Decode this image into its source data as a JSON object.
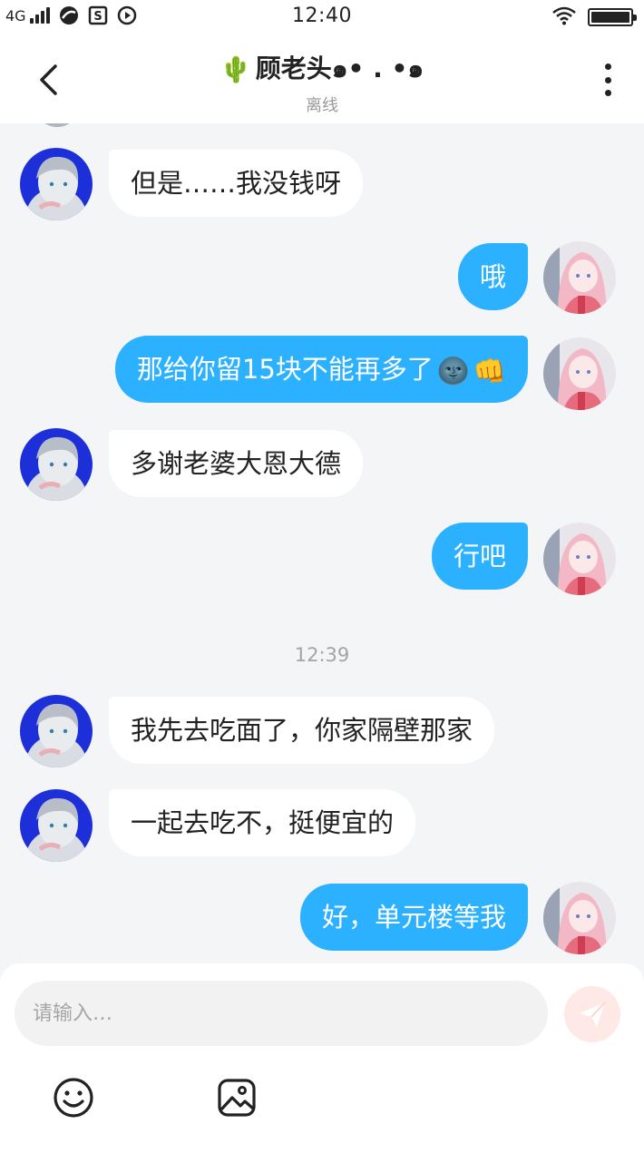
{
  "status_bar": {
    "network": "4G",
    "time": "12:40",
    "icons": [
      "signal-bars-icon",
      "browser-app-icon",
      "s-app-icon",
      "media-app-icon",
      "wifi-icon",
      "battery-icon"
    ],
    "battery_level_percent": 100
  },
  "header": {
    "title_emoji": "🌵",
    "title": "顾老头๑• . •๑",
    "subtitle": "离线",
    "icons": [
      "back-arrow-icon",
      "more-vertical-icon"
    ]
  },
  "messages": [
    {
      "side": "in",
      "text": "但是……我没钱呀"
    },
    {
      "side": "out",
      "text": "哦"
    },
    {
      "side": "out",
      "text": "那给你留15块不能再多了",
      "emojis": [
        "🌚",
        "👊"
      ]
    },
    {
      "side": "in",
      "text": "多谢老婆大恩大德"
    },
    {
      "side": "out",
      "text": "行吧"
    },
    {
      "type": "time",
      "text": "12:39"
    },
    {
      "side": "in",
      "text": "我先去吃面了，你家隔壁那家"
    },
    {
      "side": "in",
      "text": "一起去吃不，挺便宜的"
    },
    {
      "side": "out",
      "text": "好，单元楼等我"
    }
  ],
  "composer": {
    "placeholder": "请输入…",
    "value": "",
    "icons": [
      "send-icon",
      "emoji-smile-icon",
      "image-icon"
    ]
  },
  "colors": {
    "outgoing_bubble": "#2bb1ff",
    "incoming_bubble": "#ffffff",
    "background": "#f4f5f7",
    "send_button": "#ffe9e6"
  }
}
